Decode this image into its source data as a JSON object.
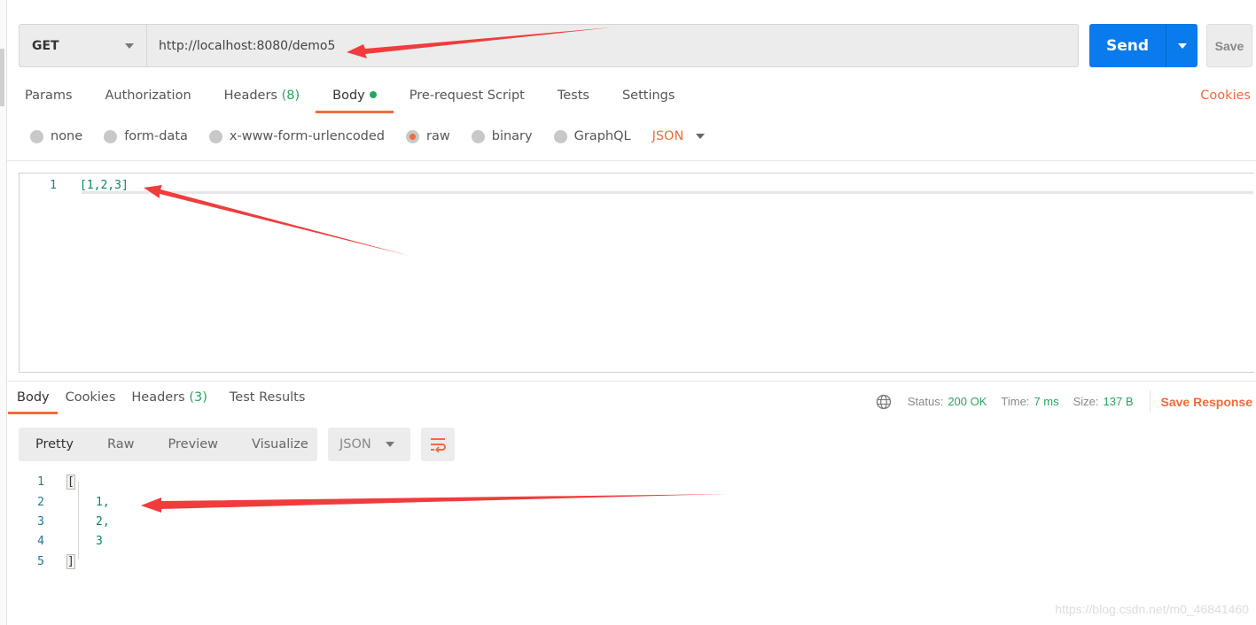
{
  "request": {
    "method": "GET",
    "url": "http://localhost:8080/demo5",
    "send_label": "Send",
    "save_label": "Save",
    "tabs": [
      {
        "label": "Params"
      },
      {
        "label": "Authorization"
      },
      {
        "label": "Headers",
        "count": "(8)"
      },
      {
        "label": "Body",
        "active": true,
        "indicator": "green-dot"
      },
      {
        "label": "Pre-request Script"
      },
      {
        "label": "Tests"
      },
      {
        "label": "Settings"
      }
    ],
    "cookies_link": "Cookies",
    "body_modes": [
      "none",
      "form-data",
      "x-www-form-urlencoded",
      "raw",
      "binary",
      "GraphQL"
    ],
    "selected_body_mode": "raw",
    "raw_format": "JSON",
    "editor_lines": [
      {
        "n": "1",
        "text": "[1,2,3]"
      }
    ]
  },
  "response": {
    "tabs": [
      {
        "label": "Body",
        "active": true
      },
      {
        "label": "Cookies"
      },
      {
        "label": "Headers",
        "count": "(3)"
      },
      {
        "label": "Test Results"
      }
    ],
    "status_label": "Status:",
    "status": "200 OK",
    "time_label": "Time:",
    "time": "7 ms",
    "size_label": "Size:",
    "size": "137 B",
    "save_response": "Save Response",
    "view_modes": [
      "Pretty",
      "Raw",
      "Preview",
      "Visualize"
    ],
    "format": "JSON",
    "lines": [
      {
        "n": "1",
        "text": "["
      },
      {
        "n": "2",
        "text": "1,"
      },
      {
        "n": "3",
        "text": "2,"
      },
      {
        "n": "4",
        "text": "3"
      },
      {
        "n": "5",
        "text": "]"
      }
    ]
  },
  "watermark": "https://blog.csdn.net/m0_46841460",
  "colors": {
    "accent": "#f26b3a",
    "send": "#097bed",
    "success": "#26a65b",
    "annotation_arrow": "#f03c3c"
  }
}
